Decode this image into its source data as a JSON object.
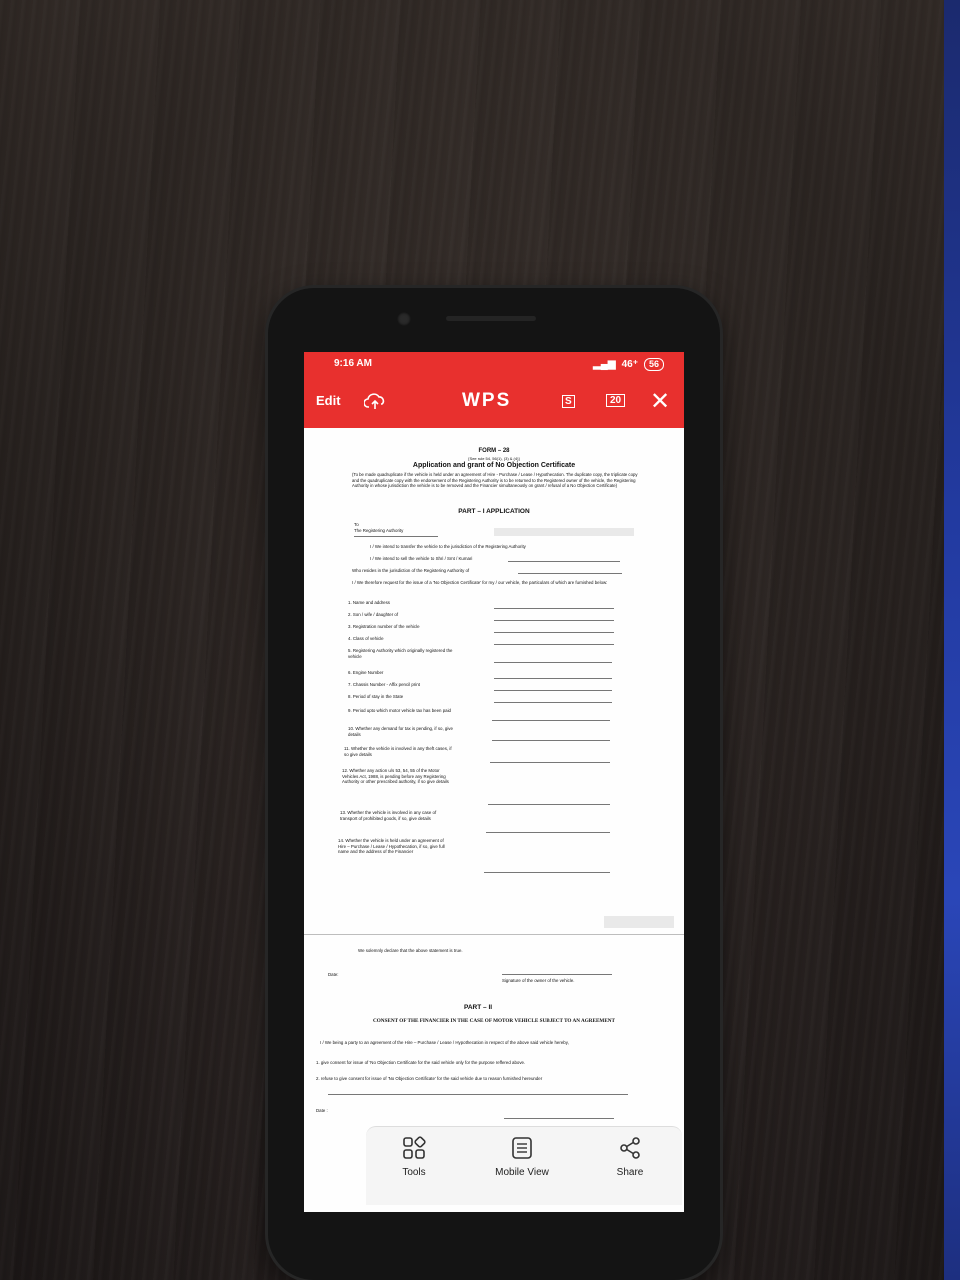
{
  "status_bar": {
    "time": "9:16 AM",
    "network": "46⁺",
    "battery": "56"
  },
  "toolbar": {
    "edit_label": "Edit",
    "logo": "WPS",
    "page_count": "20",
    "close": "✕",
    "s_badge": "S"
  },
  "document": {
    "form_title": "FORM – 28",
    "form_subtitle": "[See rule 54, 56(1), (3) & (4)]",
    "heading": "Application and grant of No Objection Certificate",
    "note": "(To be made quadruplicate if the vehicle is held under an agreement of Hire - Purchase / Lease / Hypothecation. The duplicate copy, the triplicate copy and the quadruplicate copy with the endorsement of the Registering Authority is to be returned to the Registered owner of the vehicle, the Registering Authority in whose jurisdiction the vehicle is to be removed and the Financier simultaneously on grant / refusal of a No Objection Certificate)",
    "part1_title": "PART – I APPLICATION",
    "to": "To",
    "to_line": "The Registering Authority",
    "intend_1": "I / We intend to transfer the vehicle to the jurisdiction of the Registering Authority",
    "intend_2": "I / We intend to sell the vehicle to Shri / Smt / Kumari",
    "intend_3": "Who resides in the jurisdiction of the Registering Authority of",
    "request": "I / We therefore request for the issue of a 'No Objection Certificate' for my / our vehicle, the particulars of which are furnished below:",
    "items": [
      "1.  Name and address",
      "2.  Son / wife / daughter of",
      "3.  Registration number of the vehicle",
      "4.  Class of vehicle",
      "5.  Registering Authority which originally registered the vehicle",
      "6.  Engine Number",
      "7.  Chassis Number - Affix pencil print",
      "8.  Period of stay in the State",
      "9.  Period upto which motor vehicle tax has been paid",
      "10. Whether any demand for tax is pending, if so, give details",
      "11. Whether the vehicle is involved in any theft cases, if so give details",
      "12. Whether any action u/s 53, 54, 55 of the Motor Vehicles Act, 1988, is pending before any Registering Authority or other prescribed authority, if so give details",
      "13. Whether the vehicle is involved in any case of transport of prohibited goods, if so, give details",
      "14. Whether the vehicle is held under an agreement of Hire – Purchase / Lease / Hypothecation, if so, give full name and the address of the Financier"
    ],
    "declaration": "We solemnly declare that the above statement is true.",
    "date_label": "Date:",
    "signature": "Signature of the owner of the vehicle.",
    "part2_title": "PART – II",
    "consent_heading": "CONSENT OF THE FINANCIER IN THE CASE OF MOTOR VEHICLE SUBJECT TO AN AGREEMENT",
    "consent_text": "I / We being a party to an agreement of the Hire – Purchase / Lease / Hypothecation in respect of the above said vehicle hereby,",
    "consent_items": [
      "1.  give consent for issue of 'No Objection Certificate for the said vehicle only for the purpose reffered above.",
      "2.  refuse to give consent for issue of 'No Objection Certificate' for the said vehicle due to reason furnished hereunder"
    ],
    "date_label_2": "Date :"
  },
  "bottom_bar": {
    "tools": "Tools",
    "mobile_view": "Mobile View",
    "share": "Share"
  },
  "colors": {
    "accent": "#e8302e",
    "desk": "#3b322e",
    "phone": "#141414"
  },
  "icons": [
    "cloud-upload-icon",
    "close-icon",
    "tools-grid-icon",
    "mobile-view-icon",
    "share-icon"
  ]
}
